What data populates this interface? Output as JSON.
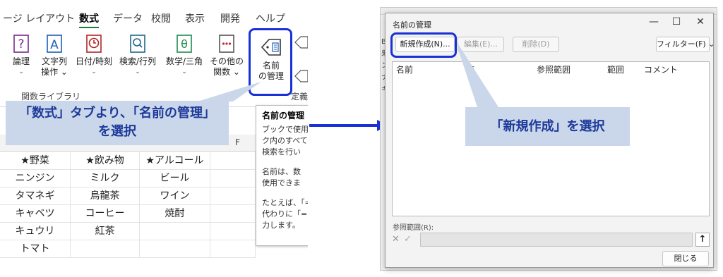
{
  "excel": {
    "tabs": [
      "ージ レイアウト",
      "数式",
      "データ",
      "校閲",
      "表示",
      "開発",
      "ヘルプ"
    ],
    "active_tab": "数式",
    "ribbon_buttons": [
      {
        "icon": "question-icon",
        "line1": "論理",
        "line2": "⌄"
      },
      {
        "icon": "text-a-icon",
        "line1": "文字列",
        "line2": "操作 ⌄"
      },
      {
        "icon": "clock-icon",
        "line1": "日付/時刻",
        "line2": "⌄"
      },
      {
        "icon": "magnifier-book-icon",
        "line1": "検索/行列",
        "line2": "⌄"
      },
      {
        "icon": "theta-icon",
        "line1": "数学/三角",
        "line2": "⌄"
      },
      {
        "icon": "more-functions-icon",
        "line1": "その他の",
        "line2": "関数 ⌄"
      },
      {
        "icon": "name-tag-icon",
        "line1": "名前",
        "line2": "の管理"
      }
    ],
    "group_label": "関数ライブラリ",
    "right_group_label": "定義",
    "tooltip": {
      "title": "名前の管理",
      "lines": [
        "ブックで使用",
        "ク内のすべて",
        "検索を行い",
        "名前は、数",
        "使用できま",
        "たとえば、「=",
        "代わりに「=",
        "力します。"
      ]
    },
    "column_header_f": "F",
    "sheet_rows": [
      [
        "★野菜",
        "★飲み物",
        "★アルコール"
      ],
      [
        "ニンジン",
        "ミルク",
        "ビール"
      ],
      [
        "タマネギ",
        "烏龍茶",
        "ワイン"
      ],
      [
        "キャベツ",
        "コーヒー",
        "焼酎"
      ],
      [
        "キュウリ",
        "紅茶",
        ""
      ],
      [
        "トマト",
        "",
        ""
      ]
    ]
  },
  "callouts": {
    "left_line1": "「数式」タブより、「名前の管理」",
    "left_line2": "を選択",
    "right": "「新規作成」を選択"
  },
  "dialog": {
    "title": "名前の管理",
    "new_button": "新規作成(N)...",
    "edit_button": "編集(E)...",
    "delete_button": "削除(D)",
    "filter_button": "フィルター(F) ⌄",
    "columns": [
      "名前",
      "値",
      "参照範囲",
      "範囲",
      "コメント"
    ],
    "ref_label": "参照範囲(R):",
    "close_button": "閉じる",
    "min_icon": "—",
    "max_icon": "☐",
    "close_icon": "✕"
  },
  "colors": {
    "highlight": "#1a31d6",
    "callout_bg": "#cad6ea",
    "callout_text": "#1d3a9a",
    "arrow": "#1a31d6"
  }
}
